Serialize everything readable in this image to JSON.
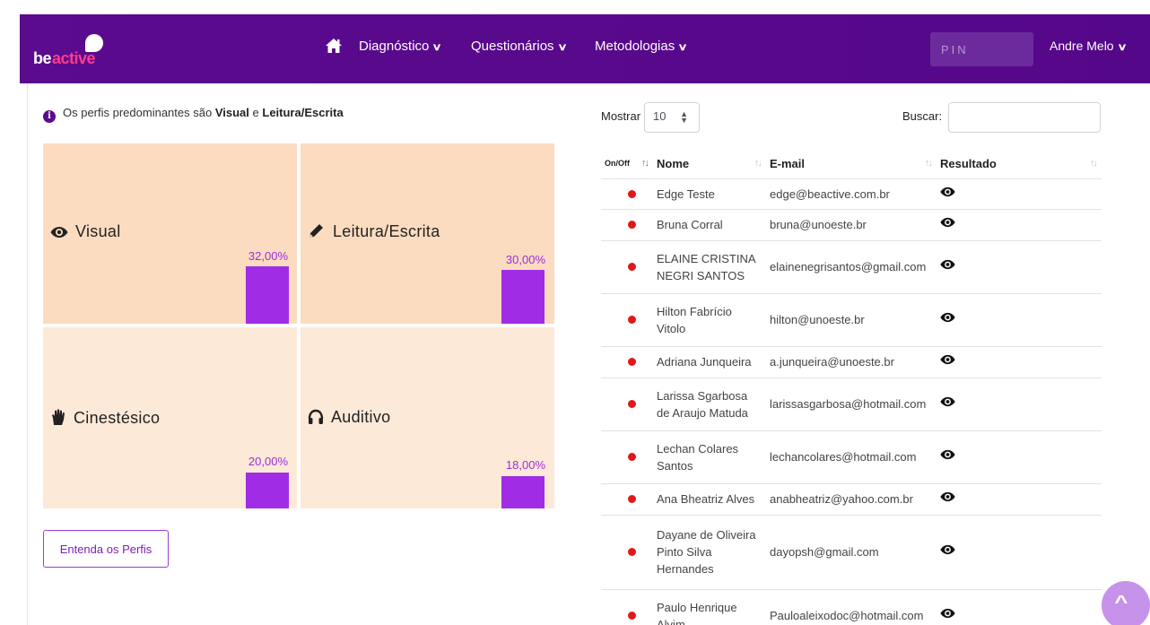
{
  "brand": {
    "be": "be",
    "active": "active"
  },
  "colors": {
    "navbar": "#5b0b8d",
    "accent": "#a02ce6",
    "status_off": "#e01818",
    "tile_top": "#fbdcc0",
    "tile_bottom": "#fde9d8"
  },
  "nav": {
    "items": [
      {
        "label": "Diagnóstico"
      },
      {
        "label": "Questionários"
      },
      {
        "label": "Metodologias"
      }
    ],
    "pin_placeholder": "PIN",
    "user": "Andre Melo"
  },
  "info": {
    "prefix": "Os perfis predominantes são",
    "first": "Visual",
    "joiner": "e",
    "second": "Leitura/Escrita"
  },
  "profiles": [
    {
      "label": "Visual",
      "percent": "32,00%",
      "value": 32.0,
      "icon": "eye-icon"
    },
    {
      "label": "Leitura/Escrita",
      "percent": "30,00%",
      "value": 30.0,
      "icon": "pencil-icon"
    },
    {
      "label": "Cinestésico",
      "percent": "20,00%",
      "value": 20.0,
      "icon": "hand-icon"
    },
    {
      "label": "Auditivo",
      "percent": "18,00%",
      "value": 18.0,
      "icon": "headphones-icon"
    }
  ],
  "entenda_button": "Entenda os Perfis",
  "table_controls": {
    "show_label": "Mostrar",
    "page_length": "10",
    "search_label": "Buscar:"
  },
  "table": {
    "headers": {
      "onoff": "On/Off",
      "name": "Nome",
      "email": "E-mail",
      "result": "Resultado"
    },
    "rows": [
      {
        "name": "Edge Teste",
        "email": "edge@beactive.com.br"
      },
      {
        "name": "Bruna Corral",
        "email": "bruna@unoeste.br"
      },
      {
        "name": "ELAINE CRISTINA NEGRI SANTOS",
        "email": "elainenegrisantos@gmail.com"
      },
      {
        "name": "Hilton Fabrício Vitolo",
        "email": "hilton@unoeste.br"
      },
      {
        "name": "Adriana Junqueira",
        "email": "a.junqueira@unoeste.br"
      },
      {
        "name": "Larissa Sgarbosa de Araujo Matuda",
        "email": "larissasgarbosa@hotmail.com"
      },
      {
        "name": "Lechan Colares Santos",
        "email": "lechancolares@hotmail.com"
      },
      {
        "name": "Ana Bheatriz Alves",
        "email": "anabheatriz@yahoo.com.br"
      },
      {
        "name": "Dayane de Oliveira Pinto Silva Hernandes",
        "email": "dayopsh@gmail.com"
      },
      {
        "name": "Paulo Henrique Alvim",
        "email": "Pauloaleixodoc@hotmail.com"
      }
    ]
  }
}
